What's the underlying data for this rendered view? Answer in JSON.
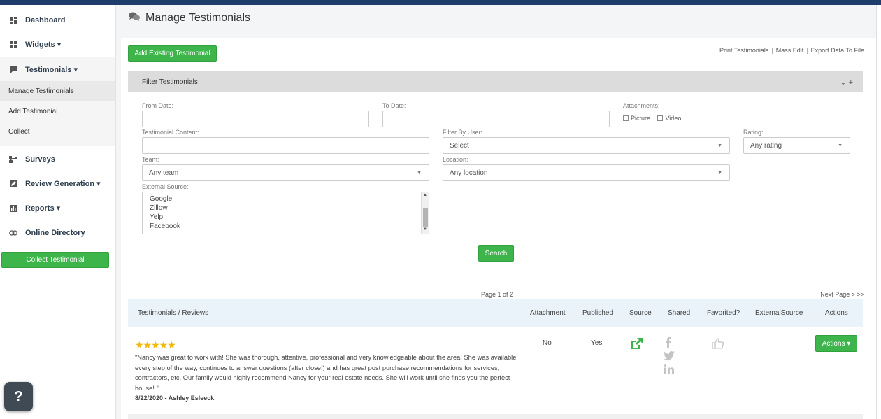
{
  "sidebar": {
    "items": [
      {
        "label": "Dashboard",
        "icon": "dashboard-icon"
      },
      {
        "label": "Widgets ▾",
        "icon": "widgets-icon"
      },
      {
        "label": "Testimonials ▾",
        "icon": "chat-icon"
      },
      {
        "label": "Surveys",
        "icon": "sitemap-icon"
      },
      {
        "label": "Review Generation ▾",
        "icon": "edit-icon"
      },
      {
        "label": "Reports ▾",
        "icon": "bar-chart-icon"
      },
      {
        "label": "Online Directory",
        "icon": "link-icon"
      }
    ],
    "sub_items": [
      "Manage Testimonials",
      "Add Testimonial",
      "Collect"
    ],
    "collect_button": "Collect Testimonial"
  },
  "help_button": "?",
  "page_title": "Manage Testimonials",
  "toolbar": {
    "add_existing": "Add Existing Testimonial",
    "links": [
      "Print Testimonials",
      "Mass Edit",
      "Export Data To File"
    ],
    "link_separator": "|"
  },
  "filter": {
    "title": "Filter Testimonials",
    "toggle": "⌄ +",
    "from_date_label": "From Date:",
    "to_date_label": "To Date:",
    "attachments_label": "Attachments:",
    "attachment_options": [
      "Picture",
      "Video"
    ],
    "content_label": "Testimonial Content:",
    "user_label": "Filter By User:",
    "user_value": "Select",
    "rating_label": "Rating:",
    "rating_value": "Any rating",
    "team_label": "Team:",
    "team_value": "Any team",
    "location_label": "Location:",
    "location_value": "Any location",
    "external_label": "External Source:",
    "external_options": [
      "Google",
      "Zillow",
      "Yelp",
      "Facebook"
    ],
    "search_button": "Search"
  },
  "pagination": {
    "page_text": "Page 1 of 2",
    "next_text": "Next Page > >>"
  },
  "table": {
    "headers": [
      "Testimonials / Reviews",
      "Attachment",
      "Published",
      "Source",
      "Shared",
      "Favorited?",
      "ExternalSource",
      "Actions"
    ],
    "rows": [
      {
        "rating": 5,
        "stars": "★★★★★",
        "text": "\"Nancy was great to work with! She was thorough, attentive, professional and very knowledgeable about the area! She was available every step of the way, continues to answer questions (after close!) and has great post purchase recommendations for services, contractors, etc. Our family would highly recommend Nancy for your real estate needs. She will work until she finds you the perfect house! \"",
        "author": "8/22/2020 - Ashley Esleeck",
        "attachment": "No",
        "published": "Yes",
        "actions": "Actions ▾"
      }
    ]
  },
  "colors": {
    "accent_green": "#3db54a",
    "top_bar": "#1f3d6b",
    "star": "#f1b90b",
    "table_header_bg": "#eaf3fa"
  }
}
